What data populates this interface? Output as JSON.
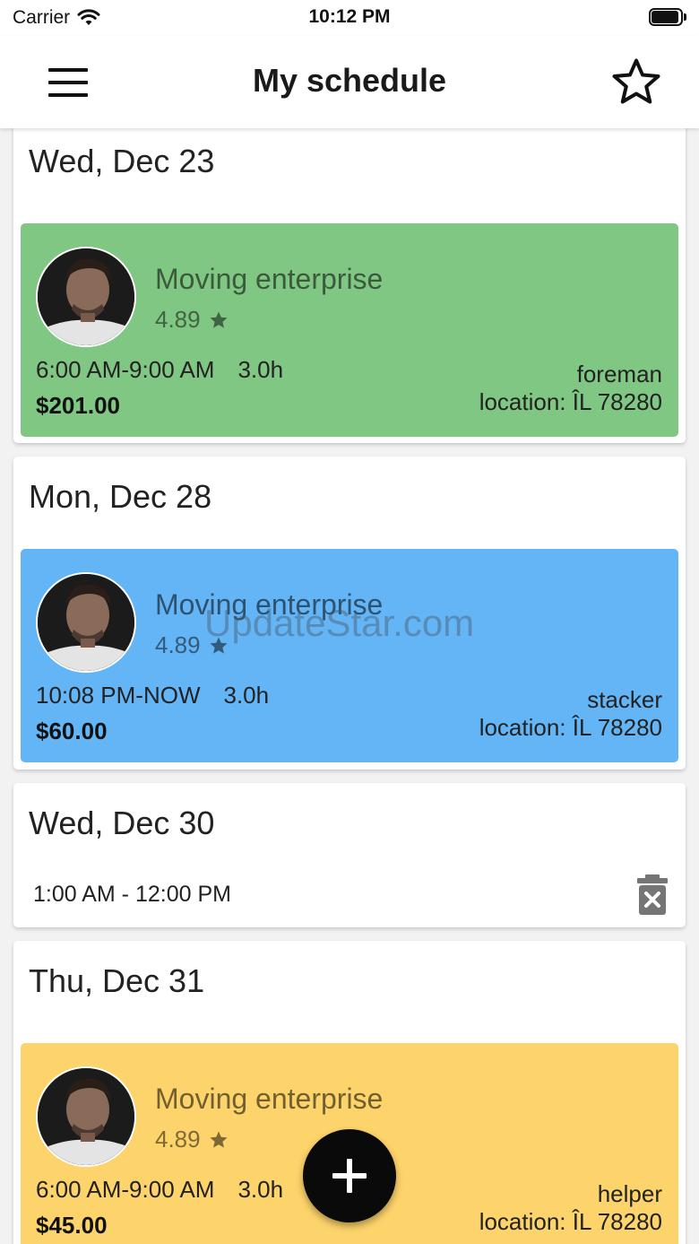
{
  "status_bar": {
    "carrier": "Carrier",
    "time": "10:12 PM"
  },
  "app_bar": {
    "title": "My schedule"
  },
  "colors": {
    "green": "#81c784",
    "blue": "#64b5f6",
    "yellow": "#fdd36b"
  },
  "days": [
    {
      "date": "Wed, Dec 23",
      "job": {
        "company": "Moving enterprise",
        "rating": "4.89",
        "time_range": "6:00 AM-9:00 AM",
        "duration": "3.0h",
        "price": "$201.00",
        "role": "foreman",
        "location": "location: ÎL 78280",
        "color": "green"
      }
    },
    {
      "date": "Mon, Dec 28",
      "job": {
        "company": "Moving enterprise",
        "rating": "4.89",
        "time_range": "10:08 PM-NOW",
        "duration": "3.0h",
        "price": "$60.00",
        "role": "stacker",
        "location": "location: ÎL 78280",
        "color": "blue"
      }
    },
    {
      "date": "Wed, Dec 30",
      "availability": "1:00 AM - 12:00 PM"
    },
    {
      "date": "Thu, Dec 31",
      "job": {
        "company": "Moving enterprise",
        "rating": "4.89",
        "time_range": "6:00 AM-9:00 AM",
        "duration": "3.0h",
        "price": "$45.00",
        "role": "helper",
        "location": "location: ÎL 78280",
        "color": "yellow"
      }
    }
  ],
  "watermark": "UpdateStar.com"
}
